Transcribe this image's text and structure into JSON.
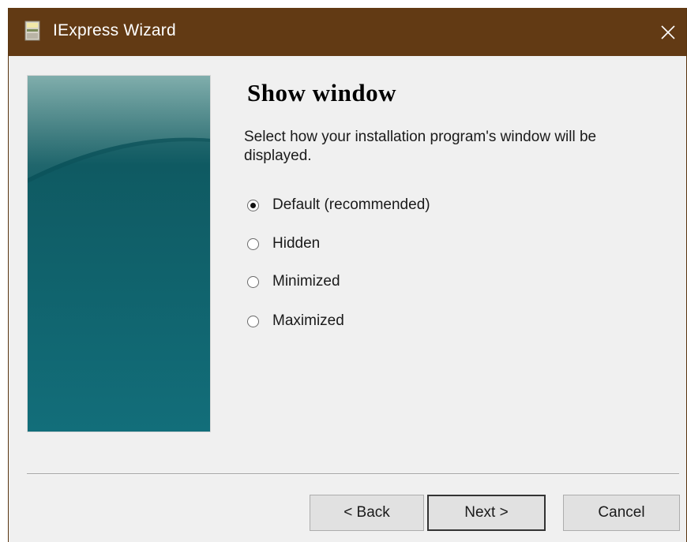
{
  "window": {
    "title": "IExpress Wizard",
    "title_bar_color": "#623a14",
    "icons": {
      "app": "iexpress-app-icon",
      "close": "close-icon"
    }
  },
  "page": {
    "heading": "Show window",
    "description": "Select how your installation program's window will be displayed."
  },
  "options": [
    {
      "label": "Default (recommended)",
      "selected": true
    },
    {
      "label": "Hidden",
      "selected": false
    },
    {
      "label": "Minimized",
      "selected": false
    },
    {
      "label": "Maximized",
      "selected": false
    }
  ],
  "buttons": {
    "back": "< Back",
    "next": "Next >",
    "cancel": "Cancel"
  }
}
